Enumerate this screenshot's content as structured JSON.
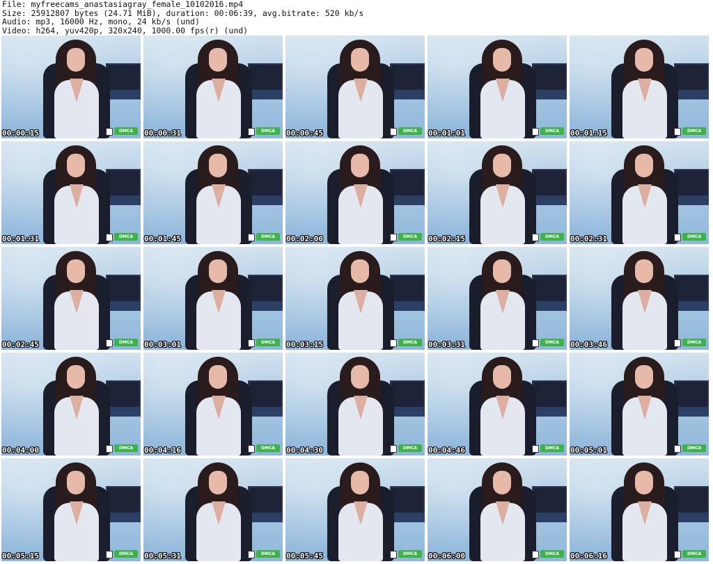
{
  "header": {
    "file": "File: myfreecams_anastasiagray_female_10102016.mp4",
    "size": "Size: 25912807 bytes (24.71 MiB), duration: 00:06:39, avg.bitrate: 520 kb/s",
    "audio": "Audio: mp3, 16000 Hz, mono, 24 kb/s (und)",
    "video": "Video: h264, yuv420p, 320x240, 1000.00 fps(r) (und)"
  },
  "badge_text": "DMCA",
  "colors": {
    "badge": "#3db34a",
    "background": "#ffffff"
  },
  "thumbnails": [
    {
      "timestamp": "00:00:15"
    },
    {
      "timestamp": "00:00:31"
    },
    {
      "timestamp": "00:00:45"
    },
    {
      "timestamp": "00:01:01"
    },
    {
      "timestamp": "00:01:15"
    },
    {
      "timestamp": "00:01:31"
    },
    {
      "timestamp": "00:01:45"
    },
    {
      "timestamp": "00:02:00"
    },
    {
      "timestamp": "00:02:15"
    },
    {
      "timestamp": "00:02:31"
    },
    {
      "timestamp": "00:02:45"
    },
    {
      "timestamp": "00:03:01"
    },
    {
      "timestamp": "00:03:15"
    },
    {
      "timestamp": "00:03:31"
    },
    {
      "timestamp": "00:03:46"
    },
    {
      "timestamp": "00:04:00"
    },
    {
      "timestamp": "00:04:16"
    },
    {
      "timestamp": "00:04:30"
    },
    {
      "timestamp": "00:04:46"
    },
    {
      "timestamp": "00:05:01"
    },
    {
      "timestamp": "00:05:15"
    },
    {
      "timestamp": "00:05:31"
    },
    {
      "timestamp": "00:05:45"
    },
    {
      "timestamp": "00:06:00"
    },
    {
      "timestamp": "00:06:16"
    }
  ]
}
